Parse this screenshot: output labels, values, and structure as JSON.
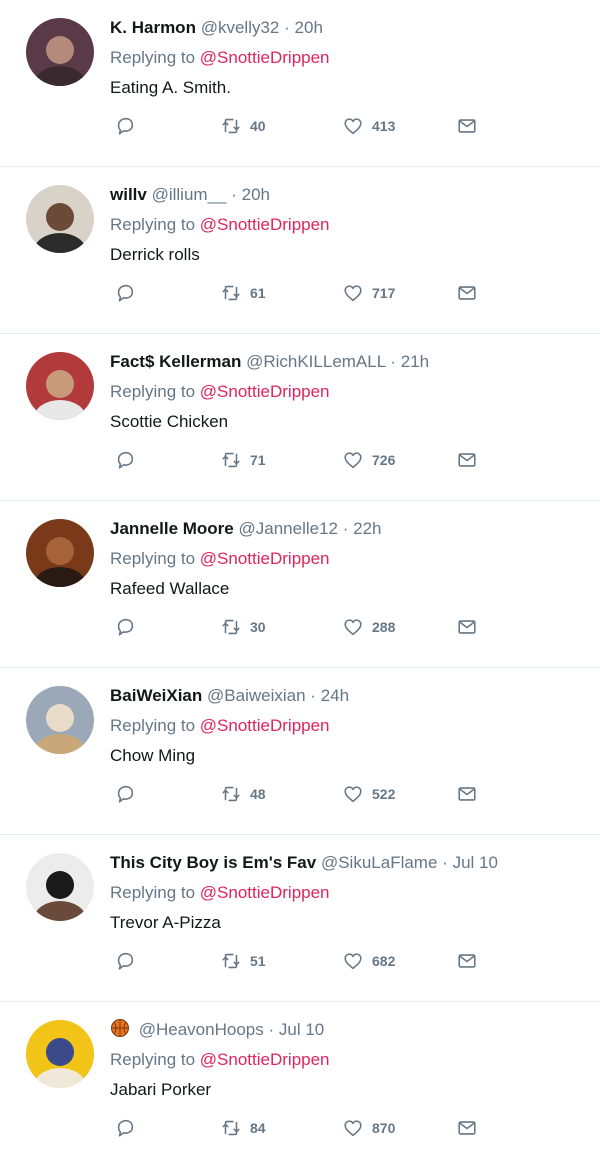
{
  "colors": {
    "name": "#14171a",
    "muted": "#657786",
    "mention": "#e0245e",
    "divider": "#e6ecf0"
  },
  "tweets": [
    {
      "name": "K. Harmon",
      "handle": "@kvelly32",
      "time": "20h",
      "reply_prefix": "Replying to",
      "reply_to": "@SnottieDrippen",
      "text": "Eating A. Smith.",
      "retweets": "40",
      "likes": "413",
      "avatar_colors": [
        "#5a3a48",
        "#b58a7a",
        "#3a2a30"
      ]
    },
    {
      "name": "willv",
      "handle": "@illium__",
      "time": "20h",
      "reply_prefix": "Replying to",
      "reply_to": "@SnottieDrippen",
      "text": "Derrick rolls",
      "retweets": "61",
      "likes": "717",
      "avatar_colors": [
        "#d9d2c8",
        "#6b4a38",
        "#2b2b2b"
      ]
    },
    {
      "name": "Fact$ Kellerman",
      "handle": "@RichKILLemALL",
      "time": "21h",
      "reply_prefix": "Replying to",
      "reply_to": "@SnottieDrippen",
      "text": "Scottie Chicken",
      "retweets": "71",
      "likes": "726",
      "avatar_colors": [
        "#b23a3a",
        "#c89a7a",
        "#e8e8e8"
      ]
    },
    {
      "name": "Jannelle Moore",
      "handle": "@Jannelle12",
      "time": "22h",
      "reply_prefix": "Replying to",
      "reply_to": "@SnottieDrippen",
      "text": "Rafeed Wallace",
      "retweets": "30",
      "likes": "288",
      "avatar_colors": [
        "#7a3a1a",
        "#a8623a",
        "#2a1a14"
      ]
    },
    {
      "name": "BaiWeiXian",
      "handle": "@Baiweixian",
      "time": "24h",
      "reply_prefix": "Replying to",
      "reply_to": "@SnottieDrippen",
      "text": "Chow Ming",
      "retweets": "48",
      "likes": "522",
      "avatar_colors": [
        "#9aa8b8",
        "#e8dcc8",
        "#c8a878"
      ]
    },
    {
      "name": "This City Boy is Em's Fav",
      "handle": "@SikuLaFlame",
      "time": "Jul 10",
      "reply_prefix": "Replying to",
      "reply_to": "@SnottieDrippen",
      "text": "Trevor A-Pizza",
      "retweets": "51",
      "likes": "682",
      "avatar_colors": [
        "#ececec",
        "#1a1a1a",
        "#6a4a3a"
      ]
    },
    {
      "name": "",
      "name_icon": "basketball-icon",
      "handle": "@HeavonHoops",
      "time": "Jul 10",
      "reply_prefix": "Replying to",
      "reply_to": "@SnottieDrippen",
      "text": "Jabari Porker",
      "retweets": "84",
      "likes": "870",
      "avatar_colors": [
        "#f2c418",
        "#3a4a8a",
        "#f0e8d8"
      ]
    }
  ]
}
